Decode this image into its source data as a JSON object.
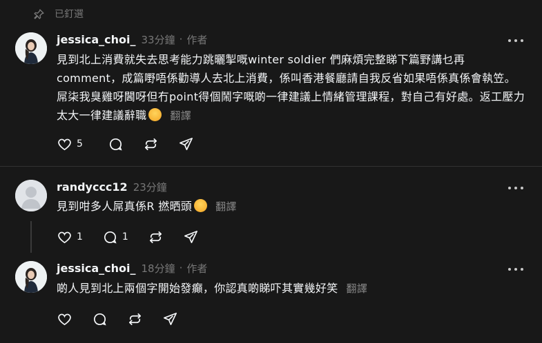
{
  "pinned": {
    "label": "已釘選",
    "icon": "pin-icon"
  },
  "posts": [
    {
      "username": "jessica_choi_",
      "time": "33分鐘",
      "author_tag": "作者",
      "text": "見到北上消費就失去思考能力跳曬掣嘅winter soldier 們麻煩完整睇下篇野講乜再comment，成篇嘢唔係勸導人去北上消費，係叫香港餐廳請自我反省如果唔係真係會執笠。屌柒我臭雞呀閪呀但冇point得個鬧字嘅啲一律建議上情緒管理課程，對自己有好處。返工壓力太大一律建議辭職",
      "emoji": "kissing-face",
      "translate": "翻譯",
      "likes": "5",
      "replies": "",
      "avatar": "profile-photo"
    },
    {
      "username": "randyccc12",
      "time": "23分鐘",
      "author_tag": "",
      "text": "見到咁多人屌真係R 撚晒頭",
      "emoji": "rolling-on-floor-laughing",
      "translate": "翻譯",
      "likes": "1",
      "replies": "1",
      "avatar": "default-avatar"
    },
    {
      "username": "jessica_choi_",
      "time": "18分鐘",
      "author_tag": "作者",
      "text": "啲人見到北上兩個字開始發癲，你認真啲睇吓其實幾好笑",
      "emoji": "",
      "translate": "翻譯",
      "likes": "",
      "replies": "",
      "avatar": "profile-photo"
    }
  ],
  "colors": {
    "background": "#181818",
    "primary_text": "#f3f5f7",
    "secondary_text": "#777777",
    "divider": "#333333"
  }
}
